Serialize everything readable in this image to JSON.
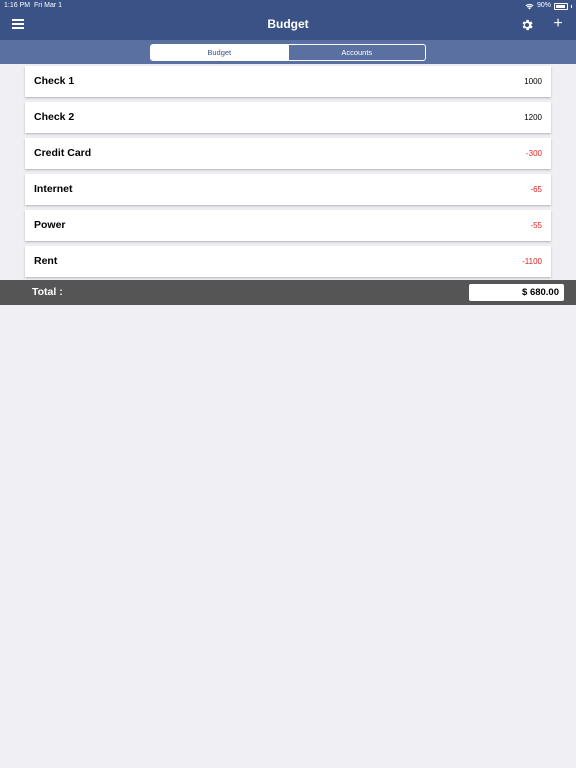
{
  "status_bar": {
    "time": "1:16 PM",
    "date": "Fri Mar 1",
    "battery_pct": "90%",
    "battery_level": 0.9
  },
  "nav": {
    "title": "Budget",
    "icons": {
      "menu": "menu-icon",
      "settings": "gear-icon",
      "add": "plus-icon"
    },
    "add_glyph": "+"
  },
  "tabs": [
    {
      "label": "Budget",
      "active": true
    },
    {
      "label": "Accounts",
      "active": false
    }
  ],
  "items": [
    {
      "name": "Check 1",
      "amount": "1000"
    },
    {
      "name": "Check 2",
      "amount": "1200"
    },
    {
      "name": "Credit Card",
      "amount": "-300"
    },
    {
      "name": "Internet",
      "amount": "-65"
    },
    {
      "name": "Power",
      "amount": "-55"
    },
    {
      "name": "Rent",
      "amount": "-1100"
    }
  ],
  "total": {
    "label": "Total :",
    "value": "$ 680.00"
  },
  "colors": {
    "header": "#3a5286",
    "segment_bar": "#5a70a0",
    "background": "#efeff4",
    "negative": "#e02020",
    "total_bar": "#555555"
  }
}
